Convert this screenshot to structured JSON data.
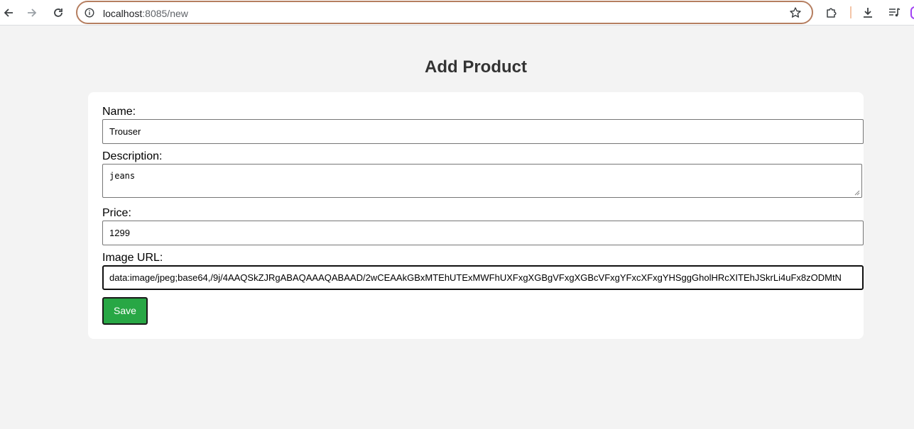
{
  "browser": {
    "url_host": "localhost",
    "url_rest": ":8085/new",
    "icons": {
      "back": "arrow-left-icon",
      "forward": "arrow-right-icon",
      "reload": "reload-icon",
      "info": "info-icon",
      "bookmark": "star-icon",
      "extensions": "puzzle-icon",
      "download": "download-icon",
      "media": "media-queue-icon"
    }
  },
  "page": {
    "title": "Add Product"
  },
  "form": {
    "name_label": "Name:",
    "name_value": "Trouser",
    "description_label": "Description:",
    "description_value": "jeans",
    "price_label": "Price:",
    "price_value": "1299",
    "image_label": "Image URL:",
    "image_value": "data:image/jpeg;base64,/9j/4AAQSkZJRgABAQAAAQABAAD/2wCEAAkGBxMTEhUTExMWFhUXFxgXGBgVFxgXGBcVFxgYFxcXFxgYHSggGholHRcXITEhJSkrLi4uFx8zODMtN",
    "save_label": "Save"
  },
  "colors": {
    "page_bg": "#f3f3f3",
    "card_bg": "#ffffff",
    "save_button": "#28a745",
    "omnibox_border": "#b57e60"
  }
}
